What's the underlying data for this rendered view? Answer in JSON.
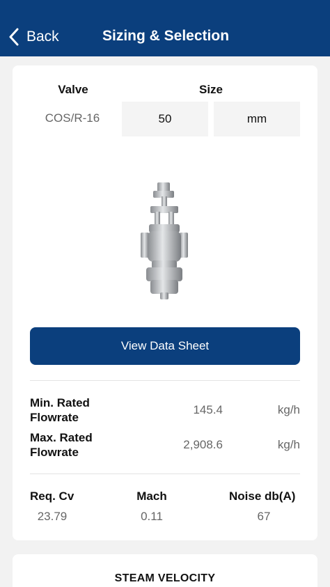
{
  "nav": {
    "back_label": "Back",
    "title": "Sizing & Selection"
  },
  "selection": {
    "valve_header": "Valve",
    "size_header": "Size",
    "valve_value": "COS/R-16",
    "size_value": "50",
    "size_unit": "mm"
  },
  "datasheet_button": "View Data Sheet",
  "flowrate": {
    "min_label": "Min. Rated Flowrate",
    "min_value": "145.4",
    "min_unit": "kg/h",
    "max_label": "Max. Rated Flowrate",
    "max_value": "2,908.6",
    "max_unit": "kg/h"
  },
  "stats": {
    "cv_label": "Req. Cv",
    "cv_value": "23.79",
    "mach_label": "Mach",
    "mach_value": "0.11",
    "noise_label": "Noise db(A)",
    "noise_value": "67"
  },
  "velocity_section": {
    "title": "STEAM VELOCITY"
  },
  "colors": {
    "brand": "#0b3f7d",
    "background": "#f2f2f2"
  }
}
